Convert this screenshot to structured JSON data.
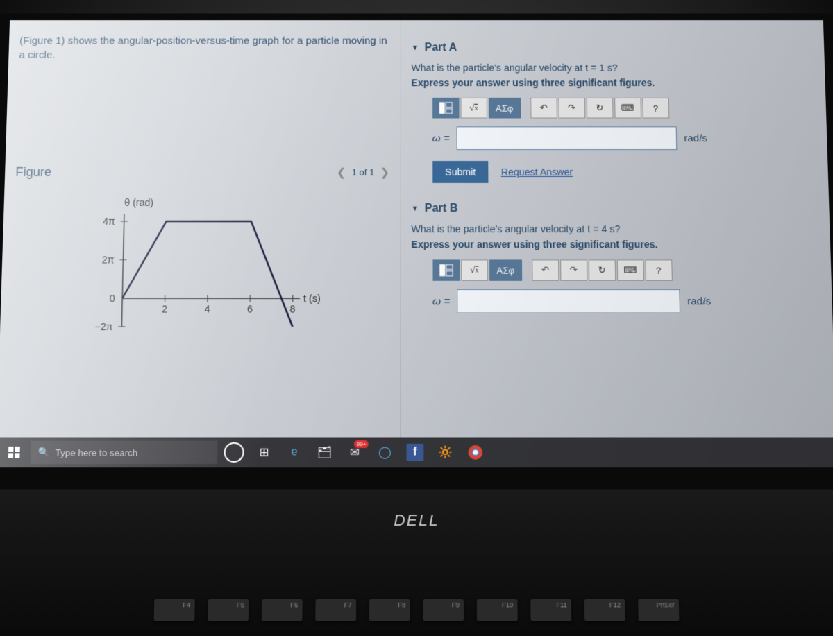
{
  "intro_text": "(Figure 1) shows the angular-position-versus-time graph for a particle moving in a circle.",
  "figure": {
    "title": "Figure",
    "nav_label": "1 of 1"
  },
  "chart_data": {
    "type": "line",
    "title": "θ (rad)",
    "xlabel": "t (s)",
    "ylabel": "θ (rad)",
    "x_ticks": [
      0,
      2,
      4,
      6,
      8
    ],
    "y_ticks_labels": [
      "−2π",
      "0",
      "2π",
      "4π"
    ],
    "y_ticks_values": [
      -6.283,
      0,
      6.283,
      12.566
    ],
    "xlim": [
      0,
      8
    ],
    "ylim": [
      -6.283,
      12.566
    ],
    "series": [
      {
        "name": "θ",
        "x": [
          0,
          2,
          6,
          8
        ],
        "y": [
          0,
          12.566,
          12.566,
          -6.283
        ]
      }
    ]
  },
  "parts": [
    {
      "label": "Part A",
      "question": "What is the particle's angular velocity at t = 1 s?",
      "instruction": "Express your answer using three significant figures.",
      "var": "ω =",
      "unit": "rad/s"
    },
    {
      "label": "Part B",
      "question": "What is the particle's angular velocity at t = 4 s?",
      "instruction": "Express your answer using three significant figures.",
      "var": "ω =",
      "unit": "rad/s"
    }
  ],
  "toolbar": {
    "greek": "ΑΣφ",
    "help": "?"
  },
  "buttons": {
    "submit": "Submit",
    "request": "Request Answer"
  },
  "taskbar": {
    "search_placeholder": "Type here to search",
    "badge": "99+"
  },
  "hardware": {
    "brand": "DELL",
    "fn_keys": [
      "F4",
      "F5",
      "F6",
      "F7",
      "F8",
      "F9",
      "F10",
      "F11",
      "F12",
      "PrtScr"
    ]
  }
}
